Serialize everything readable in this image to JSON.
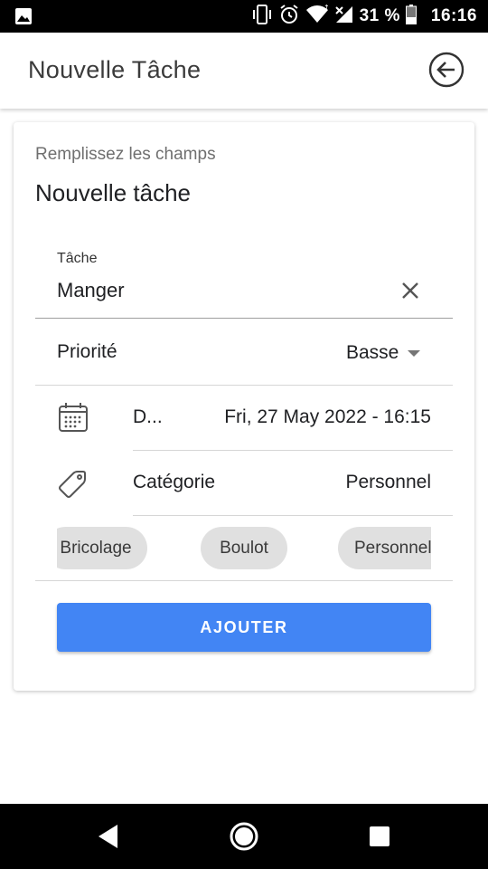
{
  "status_bar": {
    "battery_percent": "31 %",
    "time": "16:16",
    "icons": [
      "image-icon",
      "vibrate-icon",
      "alarm-icon",
      "wifi-icon",
      "signal-icon",
      "battery-icon"
    ]
  },
  "app_bar": {
    "title": "Nouvelle Tâche",
    "back_icon": "back-circle-icon"
  },
  "card": {
    "subtitle": "Remplissez les champs",
    "title": "Nouvelle tâche",
    "task_field": {
      "label": "Tâche",
      "value": "Manger",
      "clear_icon": "close-icon"
    },
    "priority": {
      "label": "Priorité",
      "value": "Basse"
    },
    "date_row": {
      "icon": "calendar-icon",
      "label": "D...",
      "value": "Fri, 27 May 2022 - 16:15"
    },
    "category_row": {
      "icon": "tag-icon",
      "label": "Catégorie",
      "value": "Personnel"
    },
    "category_chips": [
      "Bricolage",
      "Boulot",
      "Personnel"
    ],
    "submit_label": "AJOUTER"
  },
  "colors": {
    "accent": "#4285f4",
    "chip_bg": "#e0e0e0",
    "status_bar": "#000000"
  },
  "nav_bar": {
    "icons": [
      "nav-back-icon",
      "nav-home-icon",
      "nav-recents-icon"
    ]
  }
}
